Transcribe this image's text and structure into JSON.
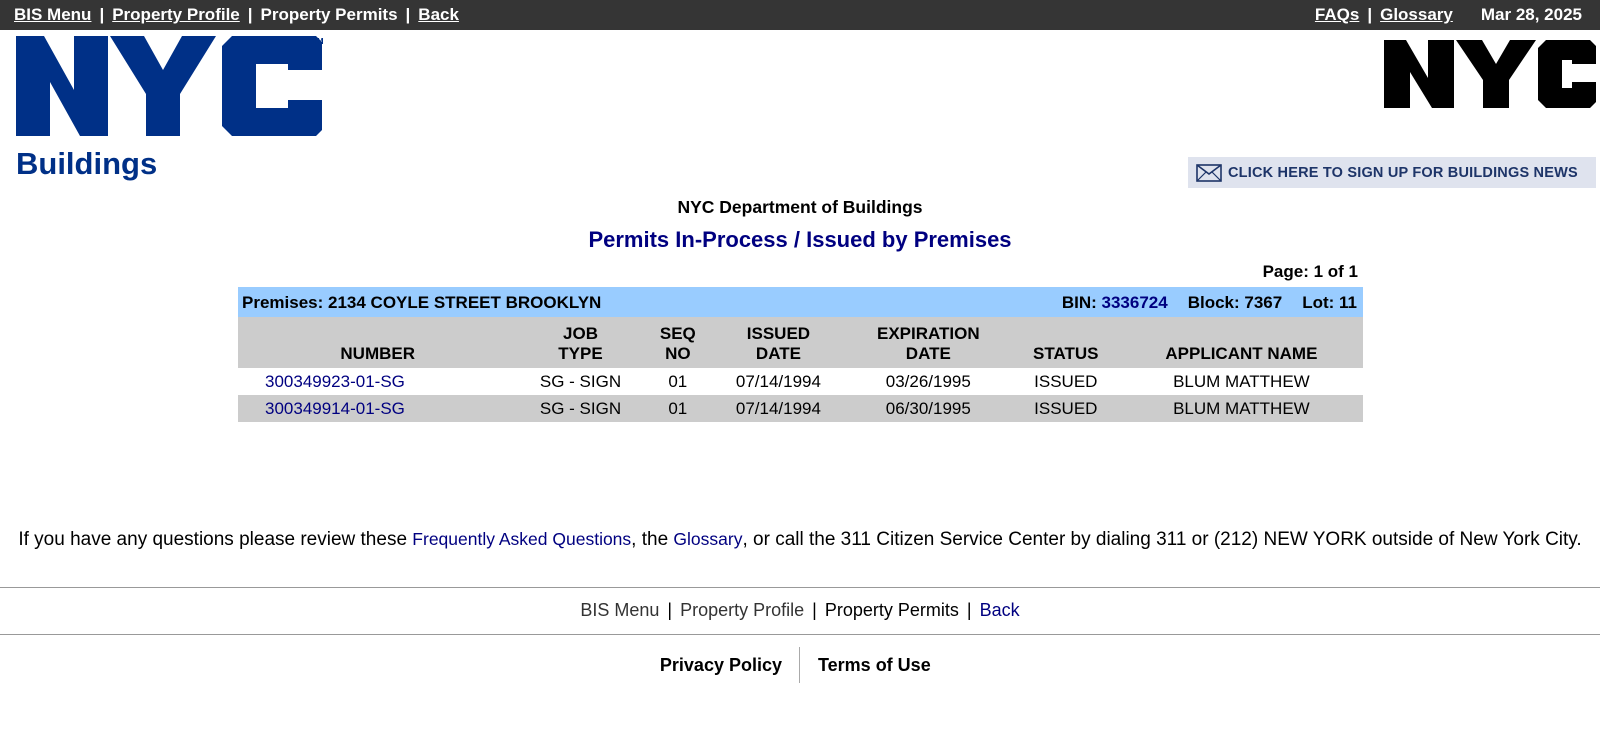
{
  "top_nav": {
    "bis_menu": "BIS Menu",
    "property_profile": "Property Profile",
    "property_permits": "Property Permits",
    "back": "Back",
    "separator": "|",
    "faqs": "FAQs",
    "glossary": "Glossary",
    "date": "Mar 28, 2025"
  },
  "logo": {
    "wordmark": "NYC",
    "subtitle": "Buildings",
    "trademark": "TM",
    "brand_color": "#003087"
  },
  "news_banner": {
    "label": "CLICK HERE TO SIGN UP FOR BUILDINGS NEWS"
  },
  "header": {
    "department": "NYC Department of Buildings",
    "title": "Permits In-Process / Issued by Premises",
    "page_info": "Page: 1 of 1"
  },
  "premises": {
    "label": "Premises: 2134 COYLE STREET BROOKLYN",
    "bin_label": "BIN:",
    "bin_value": "3336724",
    "block": "Block: 7367",
    "lot": "Lot: 11"
  },
  "table": {
    "columns": {
      "number": "NUMBER",
      "job_type_1": "JOB",
      "job_type_2": "TYPE",
      "seq_1": "SEQ",
      "seq_2": "NO",
      "issued_1": "ISSUED",
      "issued_2": "DATE",
      "exp_1": "EXPIRATION",
      "exp_2": "DATE",
      "status": "STATUS",
      "applicant": "APPLICANT NAME"
    },
    "rows": [
      {
        "number": "300349923-01-SG",
        "job_type": "SG - SIGN",
        "seq": "01",
        "issued": "07/14/1994",
        "expiration": "03/26/1995",
        "status": "ISSUED",
        "applicant": "BLUM MATTHEW"
      },
      {
        "number": "300349914-01-SG",
        "job_type": "SG - SIGN",
        "seq": "01",
        "issued": "07/14/1994",
        "expiration": "06/30/1995",
        "status": "ISSUED",
        "applicant": "BLUM MATTHEW"
      }
    ]
  },
  "help": {
    "text_1": "If you have any questions please review these ",
    "faq_link": "Frequently Asked Questions",
    "text_2": ", the ",
    "glossary_link": "Glossary",
    "text_3": ", or call the 311 Citizen Service Center by dialing 311 or (212) NEW YORK outside of New York City."
  },
  "footer_nav": {
    "bis_menu": "BIS Menu",
    "property_profile": "Property Profile",
    "property_permits": "Property Permits",
    "back": "Back",
    "separator": "|"
  },
  "legal": {
    "privacy": "Privacy Policy",
    "terms": "Terms of Use"
  }
}
